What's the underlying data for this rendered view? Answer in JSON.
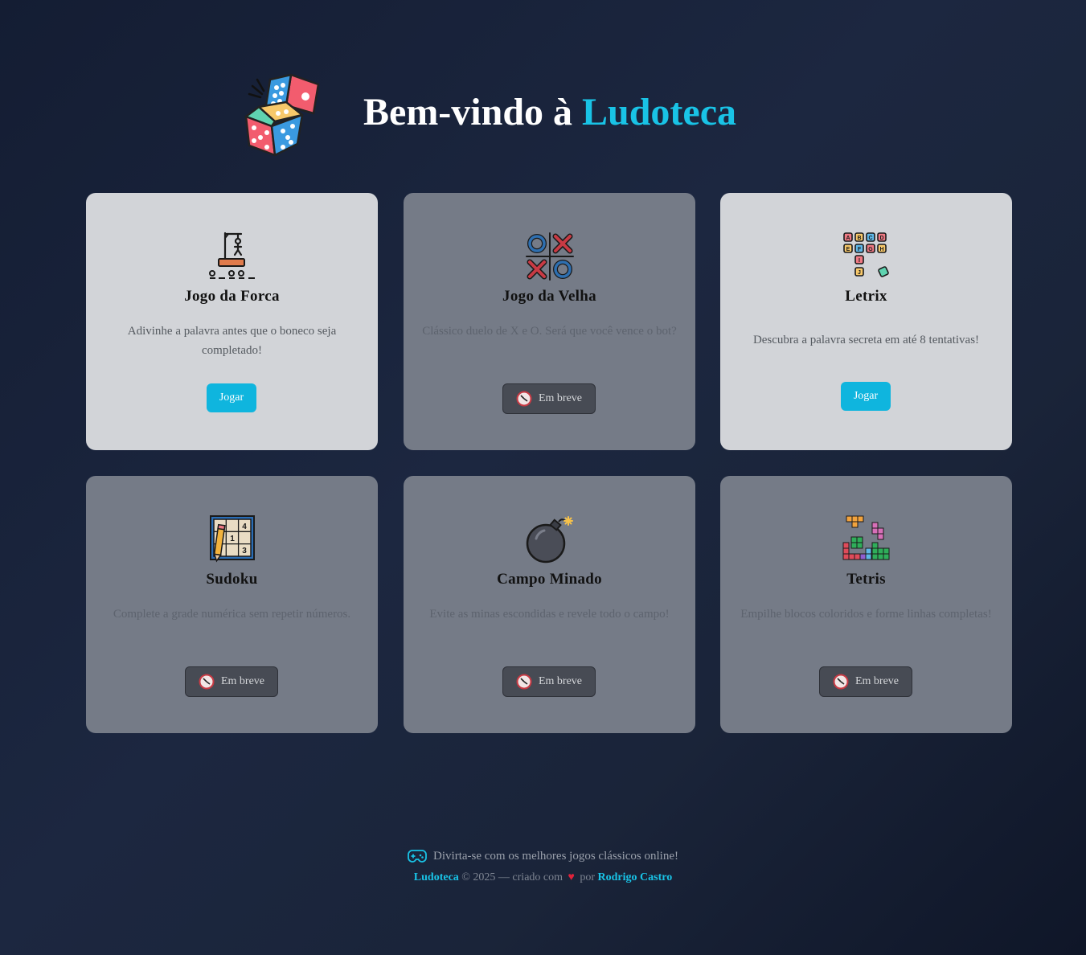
{
  "header": {
    "title_prefix": "Bem-vindo à",
    "title_accent": "Ludoteca",
    "logo_icon": "dice-icon"
  },
  "games": [
    {
      "name": "Jogo da Forca",
      "description": "Adivinhe a palavra antes que o boneco seja completado!",
      "status": "available",
      "action_label": "Jogar",
      "icon": "hangman-icon"
    },
    {
      "name": "Jogo da Velha",
      "description": "Clássico duelo de X e O. Será que você vence o bot?",
      "status": "coming-soon",
      "action_label": "Em breve",
      "icon": "tic-tac-toe-icon"
    },
    {
      "name": "Letrix",
      "description": "Descubra a palavra secreta em até 8 tentativas!",
      "status": "available",
      "action_label": "Jogar",
      "icon": "letter-blocks-icon"
    },
    {
      "name": "Sudoku",
      "description": "Complete a grade numérica sem repetir números.",
      "status": "coming-soon",
      "action_label": "Em breve",
      "icon": "sudoku-icon"
    },
    {
      "name": "Campo Minado",
      "description": "Evite as minas escondidas e revele todo o campo!",
      "status": "coming-soon",
      "action_label": "Em breve",
      "icon": "bomb-icon"
    },
    {
      "name": "Tetris",
      "description": "Empilhe blocos coloridos e forme linhas completas!",
      "status": "coming-soon",
      "action_label": "Em breve",
      "icon": "tetris-blocks-icon"
    }
  ],
  "footer": {
    "tagline": "Divirta-se com os melhores jogos clássicos online!",
    "brand": "Ludoteca",
    "copyright": "© 2025 — criado com",
    "heart": "♥",
    "by": "por",
    "author": "Rodrigo Castro"
  },
  "colors": {
    "accent": "#19c3e6",
    "play_button": "#0fb5de",
    "soon_button": "#474b54",
    "card_active": "#d2d4d8",
    "card_soon": "#757b87",
    "heart": "#e0223a"
  }
}
